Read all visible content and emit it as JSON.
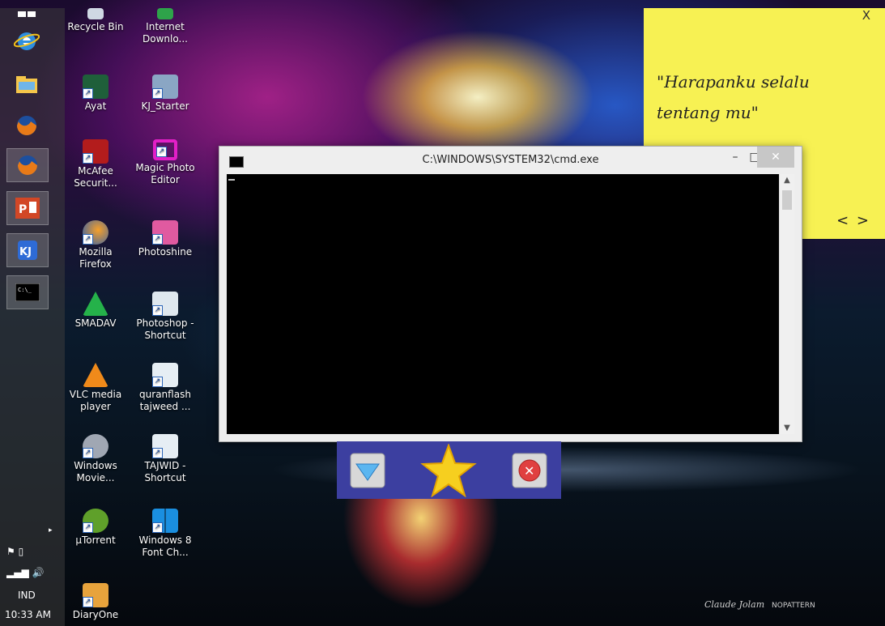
{
  "desktop_icons": [
    {
      "label": "Recycle Bin",
      "glyph": "recycle-bin-icon"
    },
    {
      "label": "Internet Downlo...",
      "glyph": "internet-download-manager-icon"
    },
    {
      "label": "Ayat",
      "glyph": "ayat-icon"
    },
    {
      "label": "KJ_Starter",
      "glyph": "kj-starter-icon"
    },
    {
      "label": "McAfee Securit...",
      "glyph": "mcafee-icon"
    },
    {
      "label": "Magic Photo Editor",
      "glyph": "magic-photo-editor-icon"
    },
    {
      "label": "Mozilla Firefox",
      "glyph": "firefox-icon"
    },
    {
      "label": "Photoshine",
      "glyph": "photoshine-icon"
    },
    {
      "label": "SMADAV",
      "glyph": "smadav-icon"
    },
    {
      "label": "Photoshop - Shortcut",
      "glyph": "photoshop-shortcut-icon"
    },
    {
      "label": "VLC media player",
      "glyph": "vlc-icon"
    },
    {
      "label": "quranflash tajweed ...",
      "glyph": "quranflash-icon"
    },
    {
      "label": "Windows Movie...",
      "glyph": "windows-movie-maker-icon"
    },
    {
      "label": "TAJWID - Shortcut",
      "glyph": "tajwid-shortcut-icon"
    },
    {
      "label": "µTorrent",
      "glyph": "utorrent-icon"
    },
    {
      "label": "Windows 8 Font Ch...",
      "glyph": "windows8-font-icon"
    },
    {
      "label": "DiaryOne",
      "glyph": "diaryone-icon"
    }
  ],
  "taskbar": {
    "buttons": [
      "start-icon",
      "internet-explorer-icon",
      "file-explorer-icon",
      "firefox-icon",
      "firefox-icon",
      "powerpoint-icon",
      "kj-icon",
      "cmd-icon"
    ],
    "language": "IND",
    "clock": "10:33 AM"
  },
  "sticky": {
    "close_label": "X",
    "text": "\"Harapanku selalu tentang mu\"",
    "nav_label": "< >"
  },
  "cmd": {
    "title": "C:\\WINDOWS\\SYSTEM32\\cmd.exe",
    "icon_label": "C:\\",
    "minimize": "–",
    "maximize": "□",
    "close": "✕"
  },
  "dock": {
    "items": [
      "download-arrow-icon",
      "star-icon",
      "close-circle-icon"
    ]
  },
  "watermark": {
    "brand": "NOPATTERN"
  },
  "colors": {
    "sticky": "#f7f153",
    "cmd_bg": "#000000",
    "dock": "#3c3fa0"
  }
}
